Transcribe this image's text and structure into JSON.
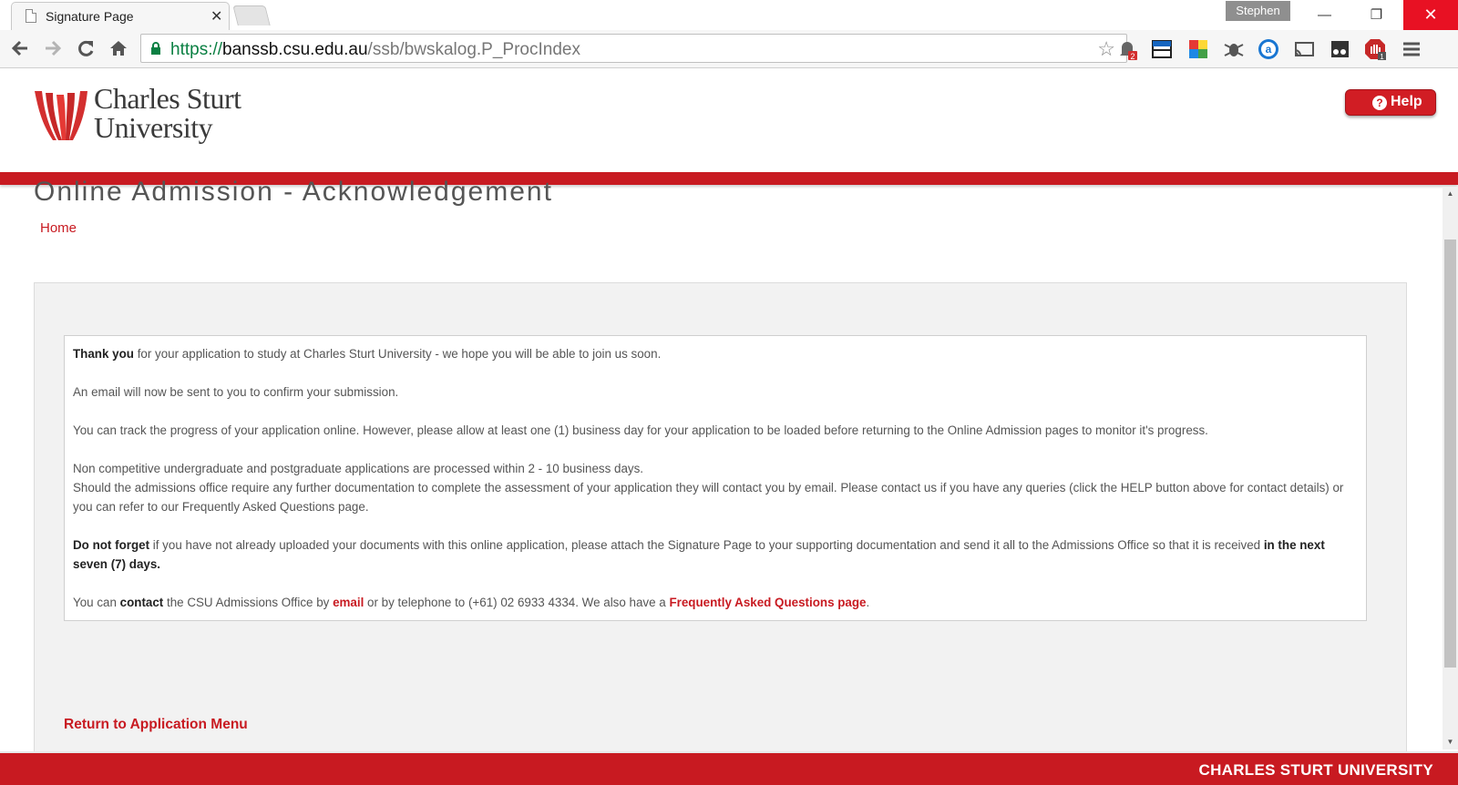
{
  "browser": {
    "tab_title": "Signature Page",
    "tab_close": "✕",
    "profile_name": "Stephen",
    "url_scheme": "https://",
    "url_host": "banssb.csu.edu.au",
    "url_path": "/ssb/bwskalog.P_ProcIndex",
    "notification_badge": "2",
    "extension_badge": "1"
  },
  "header": {
    "logo_line1": "Charles Sturt",
    "logo_line2": "University",
    "help_label": "Help",
    "help_icon_glyph": "?"
  },
  "page": {
    "title": "Online Admission - Acknowledgement",
    "home_link": "Home"
  },
  "message": {
    "p1_bold": "Thank you",
    "p1_rest": " for your application to study at Charles Sturt University - we hope you will be able to join us soon.",
    "p2": "An email will now be sent to you to confirm your submission.",
    "p3": "You can track the progress of your application online. However, please allow at least one (1) business day for your application to be loaded before returning to the Online Admission pages to monitor it's progress.",
    "p4_line1": "Non competitive undergraduate and postgraduate applications are processed within 2 - 10 business days.",
    "p4_line2": "Should the admissions office require any further documentation to complete the assessment of your application they will contact you by email. Please contact us if you have any queries (click the HELP button above for contact details) or you can refer to our Frequently Asked Questions page.",
    "p5_bold": "Do not forget",
    "p5_rest": " if you have not already uploaded your documents with this online application, please attach the Signature Page to your supporting documentation and send it all to the Admissions Office so that it is received ",
    "p5_bold_end": "in the next seven (7) days.",
    "p6_a": "You can ",
    "p6_bold": "contact",
    "p6_b": " the CSU Admissions Office by ",
    "p6_email": "email",
    "p6_c": " or by telephone to (+61) 02 6933 4334. We also have a ",
    "p6_faq": "Frequently Asked Questions page",
    "p6_end": "."
  },
  "return_link": "Return to Application Menu",
  "footer_text": "CHARLES STURT UNIVERSITY",
  "colors": {
    "brand_red": "#c81a21",
    "panel_bg": "#f2f2f2"
  }
}
